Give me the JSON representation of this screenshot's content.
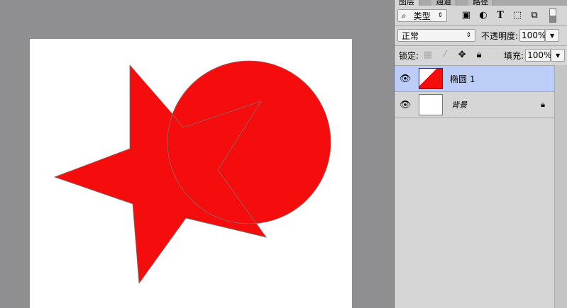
{
  "panel": {
    "tabs": [
      "图层",
      "通道",
      "路径"
    ],
    "filter": {
      "label": "类型",
      "icons": [
        "image-filter-icon",
        "adjustment-filter-icon",
        "type-filter-icon",
        "shape-filter-icon",
        "smart-object-filter-icon"
      ]
    },
    "blend_mode": "正常",
    "opacity_label": "不透明度:",
    "opacity": "100%",
    "lock_label": "锁定:",
    "fill_label": "填充:",
    "fill": "100%",
    "layers": [
      {
        "name": "椭圆 1",
        "selected": true,
        "visible": true
      },
      {
        "name": "背景",
        "selected": false,
        "visible": true,
        "locked": true
      }
    ]
  },
  "colors": {
    "shape_fill": "#f50d0d",
    "selected_layer": "#bccdf8"
  }
}
